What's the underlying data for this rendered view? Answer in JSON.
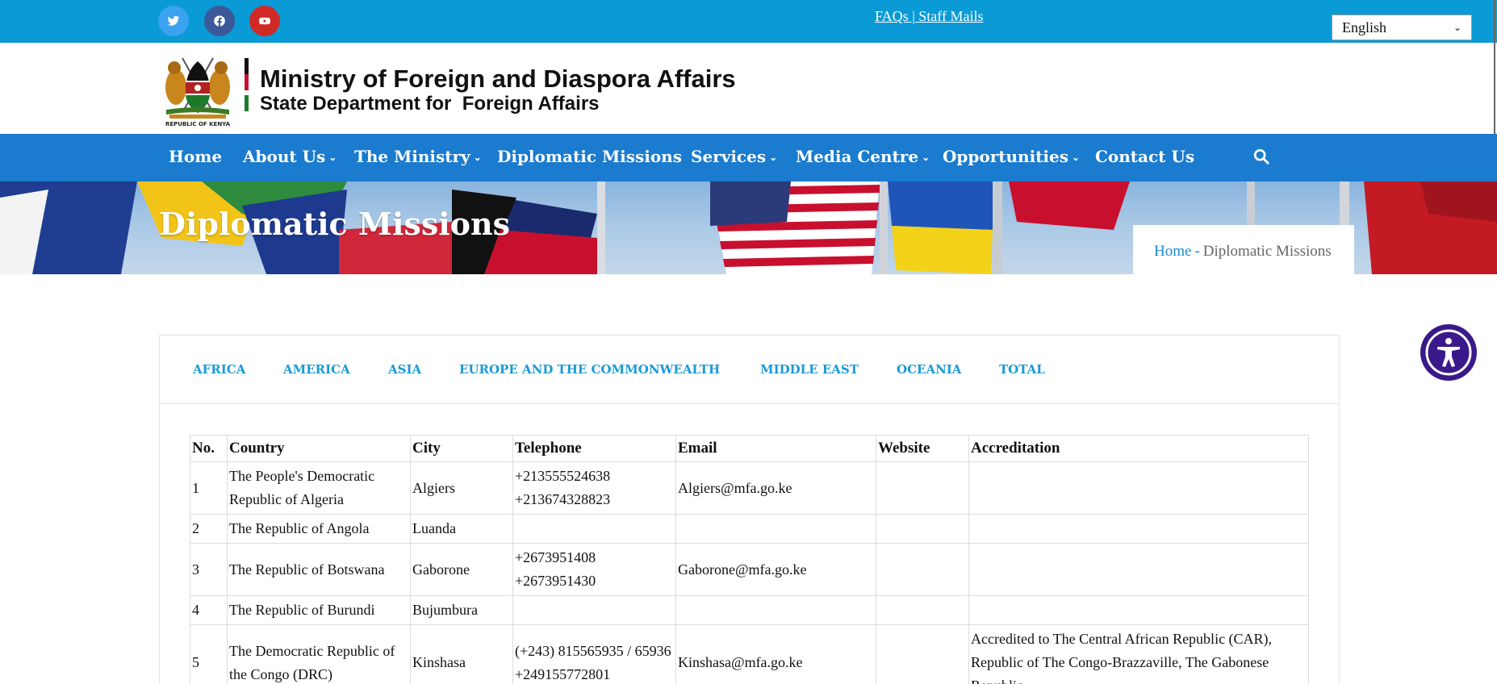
{
  "topbar": {
    "social": [
      {
        "name": "twitter",
        "icon": "twitter-icon",
        "color": "#3ba2f0"
      },
      {
        "name": "facebook",
        "icon": "facebook-icon",
        "color": "#3b5998"
      },
      {
        "name": "youtube",
        "icon": "youtube-icon",
        "color": "#d12a25"
      }
    ],
    "faqs_label": "FAQs",
    "separator": " | ",
    "staff_mails_label": "Staff Mails",
    "language_selected": "English"
  },
  "header": {
    "logo_caption": "REPUBLIC OF KENYA",
    "title": "Ministry of Foreign and Diaspora Affairs",
    "subtitle": "State Department for  Foreign Affairs"
  },
  "nav": {
    "items": [
      {
        "label": "Home",
        "has_dropdown": false
      },
      {
        "label": "About Us",
        "has_dropdown": true
      },
      {
        "label": "The Ministry",
        "has_dropdown": true
      },
      {
        "label": "Diplomatic Missions",
        "has_dropdown": false
      },
      {
        "label": "Services",
        "has_dropdown": true
      },
      {
        "label": "Media Centre",
        "has_dropdown": true
      },
      {
        "label": "Opportunities",
        "has_dropdown": true
      },
      {
        "label": "Contact Us",
        "has_dropdown": false
      }
    ],
    "search_icon": "search-icon"
  },
  "banner": {
    "title": "Diplomatic Missions",
    "breadcrumb_home": "Home",
    "breadcrumb_sep": "-",
    "breadcrumb_current": "Diplomatic Missions"
  },
  "tabs": [
    "AFRICA",
    "AMERICA",
    "ASIA",
    "EUROPE AND THE COMMONWEALTH",
    "MIDDLE EAST",
    "OCEANIA",
    "TOTAL"
  ],
  "table": {
    "headers": [
      "No.",
      "Country",
      "City",
      "Telephone",
      "Email",
      "Website",
      "Accreditation"
    ],
    "rows": [
      [
        "1",
        "The People's Democratic Republic of Algeria",
        "Algiers",
        "+213555524638\n+213674328823",
        "Algiers@mfa.go.ke",
        "",
        ""
      ],
      [
        "2",
        "The Republic of Angola",
        "Luanda",
        "",
        "",
        "",
        ""
      ],
      [
        "3",
        "The Republic of Botswana",
        "Gaborone",
        "+2673951408\n+2673951430",
        "Gaborone@mfa.go.ke",
        "",
        ""
      ],
      [
        "4",
        "The Republic of Burundi",
        "Bujumbura",
        "",
        "",
        "",
        ""
      ],
      [
        "5",
        "The Democratic Republic of the Congo (DRC)",
        "Kinshasa",
        "(+243) 815565935 / 65936 +249155772801",
        "Kinshasa@mfa.go.ke",
        "",
        "Accredited to The Central African Republic (CAR), Republic of The Congo-Brazzaville, The Gabonese Republic"
      ]
    ]
  },
  "accessibility_icon": "accessibility-icon",
  "colors": {
    "topbar": "#0a9ad6",
    "nav": "#1a7bcf",
    "tab_text": "#1a9ad6",
    "accessibility": "#3a1a8a"
  }
}
